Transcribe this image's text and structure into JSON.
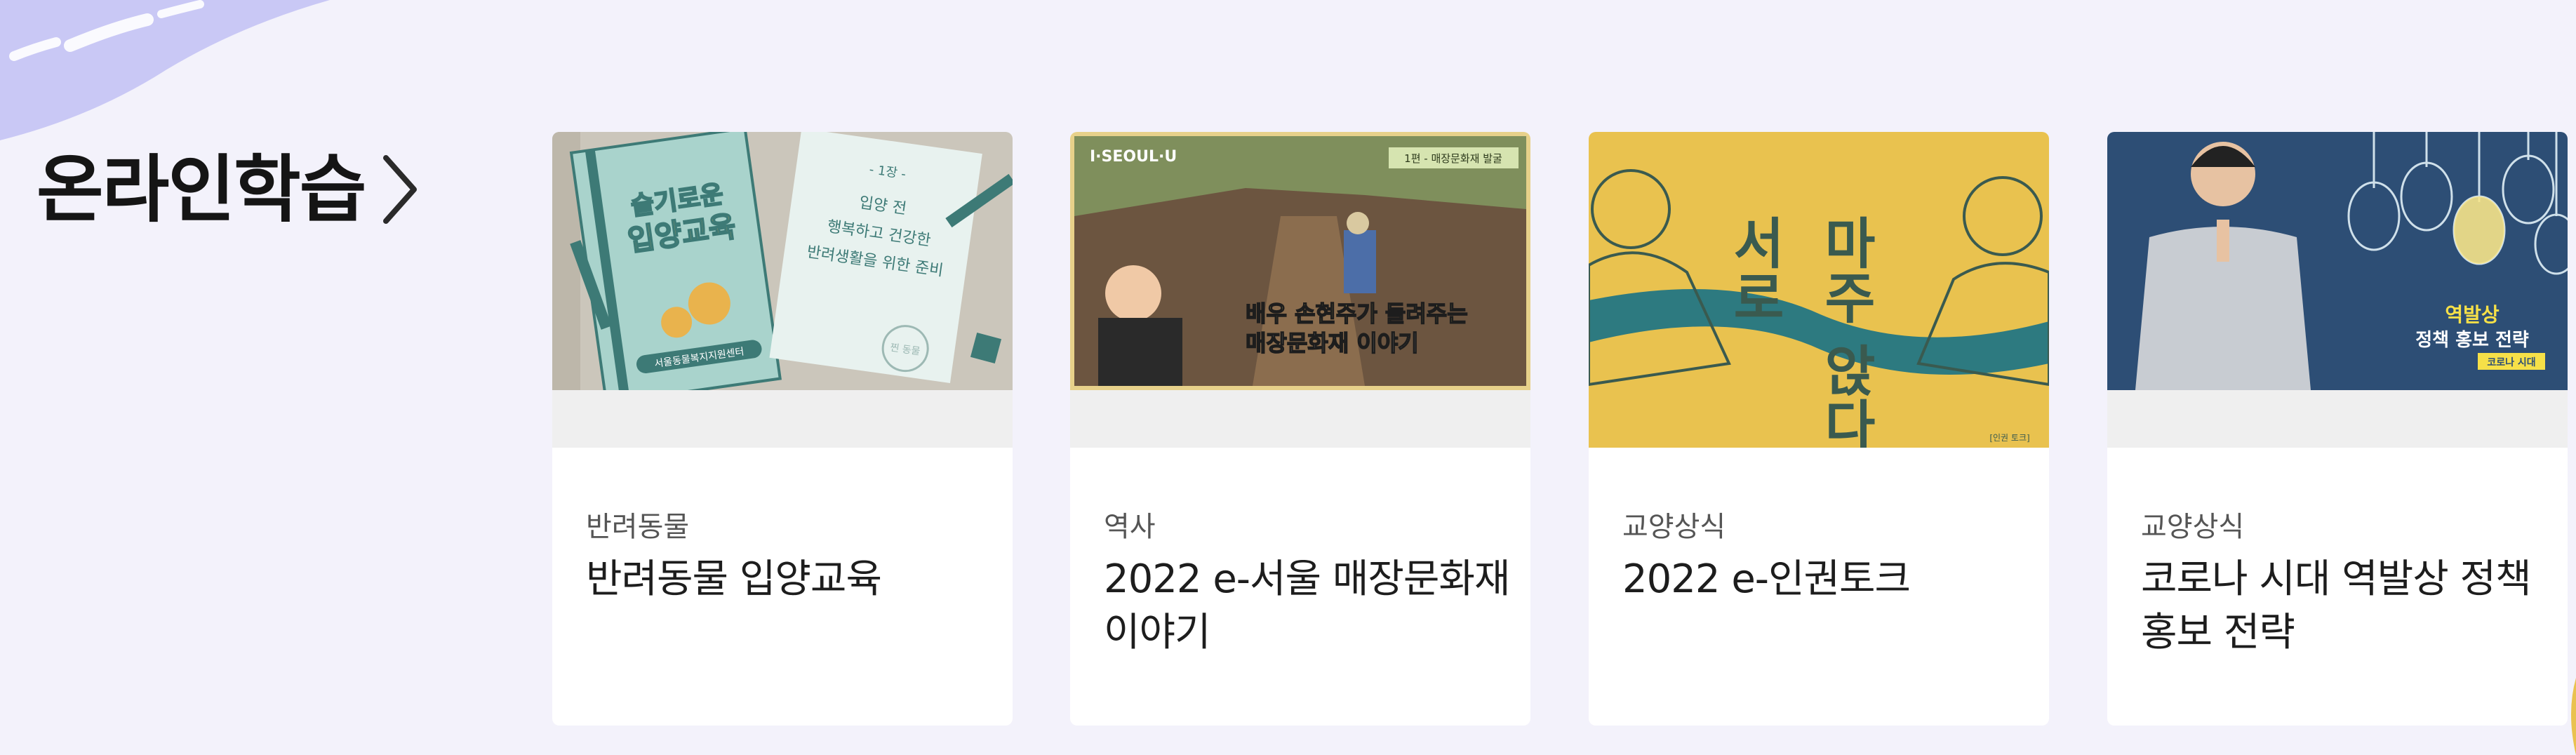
{
  "section": {
    "title": "온라인학습"
  },
  "cards": [
    {
      "category": "반려동물",
      "title": "반려동물 입양교육",
      "thumb_text": [
        "슬기로운",
        "입양교육",
        "- 1장 -",
        "입양 전",
        "행복하고 건강한",
        "반려생활을 위한 준비",
        "서울동물복지지원센터",
        "찐 동물"
      ]
    },
    {
      "category": "역사",
      "title": "2022 e-서울 매장문화재 이야기",
      "thumb_text": [
        "I·SEOUL·U",
        "1편 - 매장문화재 발굴",
        "배우 손현주가 들려주는",
        "매장문화재 이야기"
      ]
    },
    {
      "category": "교양상식",
      "title": "2022 e-인권토크",
      "thumb_text": [
        "서로",
        "마주",
        "앉다",
        "[인권 토크]"
      ]
    },
    {
      "category": "교양상식",
      "title": "코로나 시대 역발상 정책 홍보 전략",
      "thumb_text": [
        "역발상",
        "정책 홍보 전략",
        "코로나 시대"
      ]
    }
  ],
  "colors": {
    "background": "#f3f2fb",
    "decoration": "#c9c8f5",
    "title": "#151515",
    "category": "#555555",
    "card_title": "#1d1d1d",
    "thumb_yellow": "#e9c24f",
    "thumb_teal": "#2d7a80",
    "thumb_blue": "#2d4e75"
  },
  "icons": {
    "section_arrow": "chevron-right-icon"
  }
}
